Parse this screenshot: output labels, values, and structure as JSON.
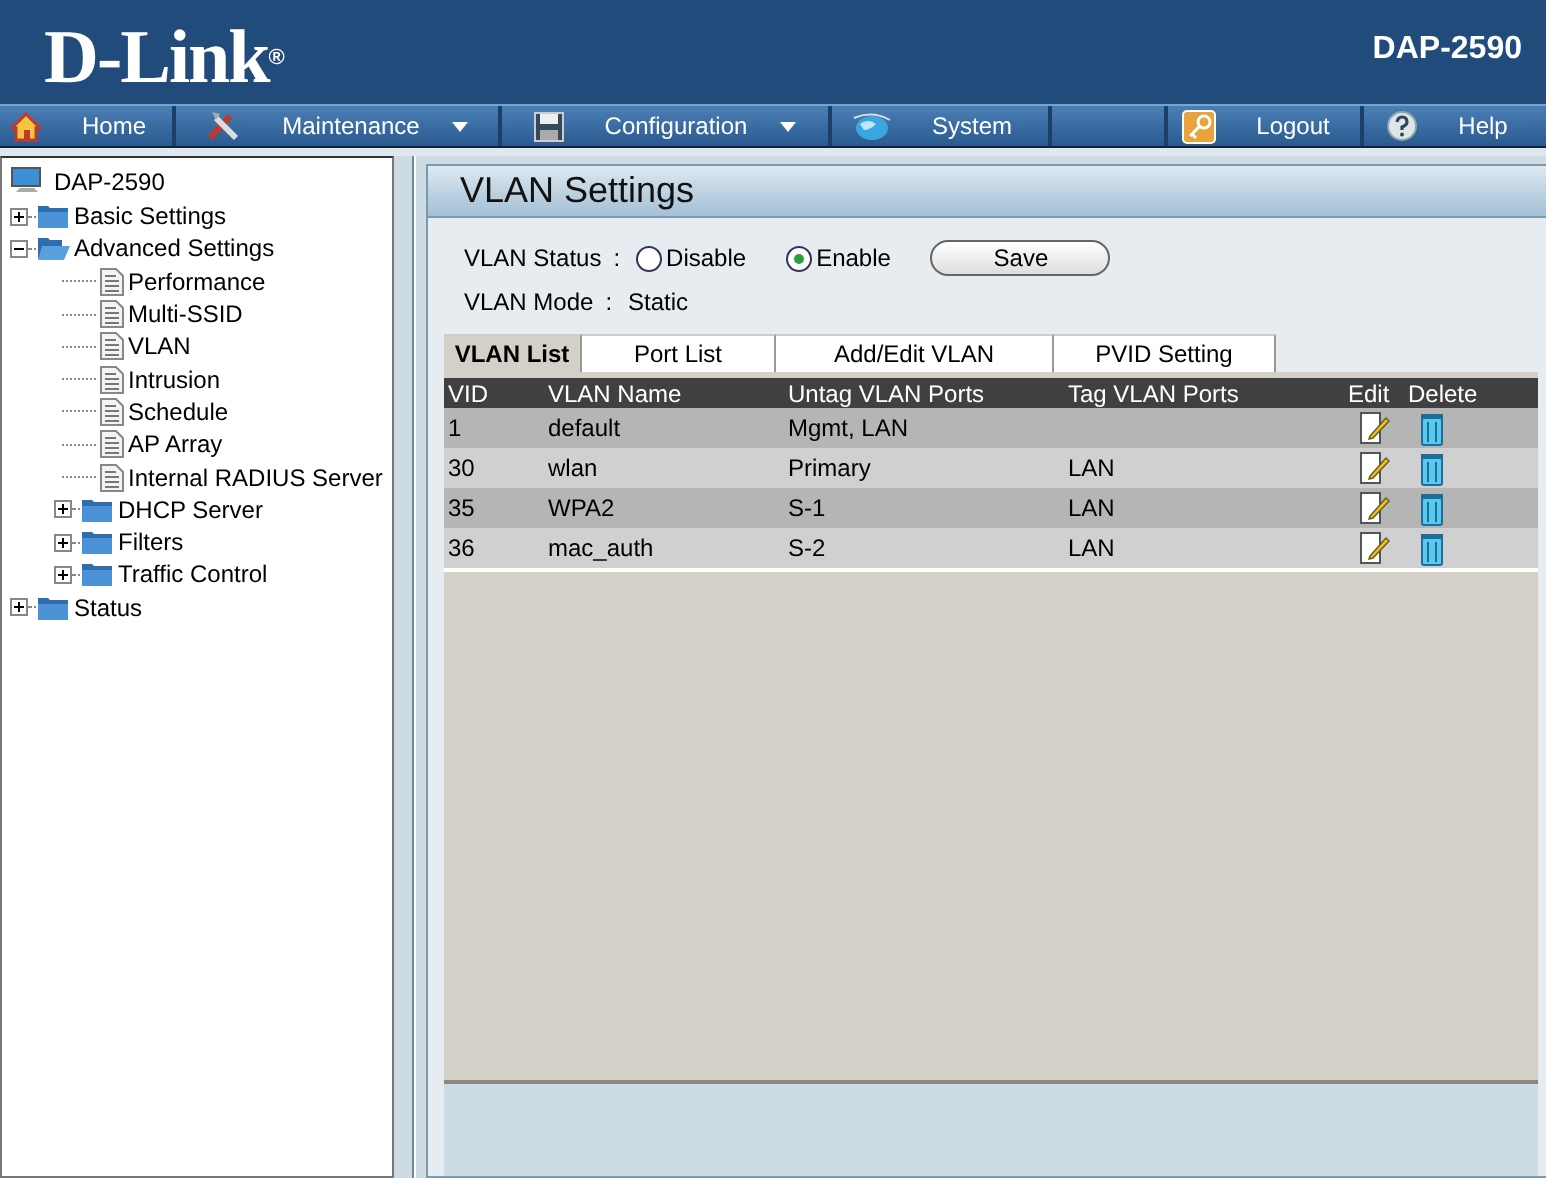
{
  "header": {
    "logo": "D-Link",
    "logo_mark": "®",
    "model": "DAP-2590"
  },
  "nav": [
    {
      "label": "Home",
      "kind": "home",
      "dropdown": false
    },
    {
      "label": "Maintenance",
      "kind": "tools",
      "dropdown": true
    },
    {
      "label": "Configuration",
      "kind": "disk",
      "dropdown": true
    },
    {
      "label": "System",
      "kind": "globe",
      "dropdown": false
    },
    {
      "label": "Logout",
      "kind": "key",
      "dropdown": false
    },
    {
      "label": "Help",
      "kind": "help",
      "dropdown": false
    }
  ],
  "tree": {
    "root": "DAP-2590",
    "items": [
      {
        "label": "Basic Settings",
        "kind": "folder",
        "expanded": false
      },
      {
        "label": "Advanced Settings",
        "kind": "folder",
        "expanded": true,
        "children": [
          {
            "label": "Performance",
            "kind": "page"
          },
          {
            "label": "Multi-SSID",
            "kind": "page"
          },
          {
            "label": "VLAN",
            "kind": "page"
          },
          {
            "label": "Intrusion",
            "kind": "page"
          },
          {
            "label": "Schedule",
            "kind": "page"
          },
          {
            "label": "AP Array",
            "kind": "page"
          },
          {
            "label": "Internal RADIUS Server",
            "kind": "page"
          },
          {
            "label": "DHCP Server",
            "kind": "folder",
            "expanded": false
          },
          {
            "label": "Filters",
            "kind": "folder",
            "expanded": false
          },
          {
            "label": "Traffic Control",
            "kind": "folder",
            "expanded": false
          }
        ]
      },
      {
        "label": "Status",
        "kind": "folder",
        "expanded": false
      }
    ]
  },
  "panel": {
    "title": "VLAN Settings",
    "vlan_status": {
      "label": "VLAN Status",
      "separator": ":",
      "options": [
        {
          "label": "Disable",
          "selected": false
        },
        {
          "label": "Enable",
          "selected": true
        }
      ]
    },
    "save_button": "Save",
    "vlan_mode": {
      "label": "VLAN Mode",
      "separator": ":",
      "value": "Static"
    },
    "tabs": [
      {
        "label": "VLAN List",
        "selected": true
      },
      {
        "label": "Port List",
        "selected": false
      },
      {
        "label": "Add/Edit VLAN",
        "selected": false
      },
      {
        "label": "PVID Setting",
        "selected": false
      }
    ],
    "table": {
      "columns": [
        "VID",
        "VLAN Name",
        "Untag VLAN Ports",
        "Tag VLAN Ports",
        "Edit",
        "Delete"
      ],
      "rows": [
        {
          "vid": "1",
          "name": "default",
          "untag": "Mgmt, LAN",
          "tag": ""
        },
        {
          "vid": "30",
          "name": "wlan",
          "untag": "Primary",
          "tag": "LAN"
        },
        {
          "vid": "35",
          "name": "WPA2",
          "untag": "S-1",
          "tag": "LAN"
        },
        {
          "vid": "36",
          "name": "mac_auth",
          "untag": "S-2",
          "tag": "LAN"
        }
      ]
    }
  }
}
